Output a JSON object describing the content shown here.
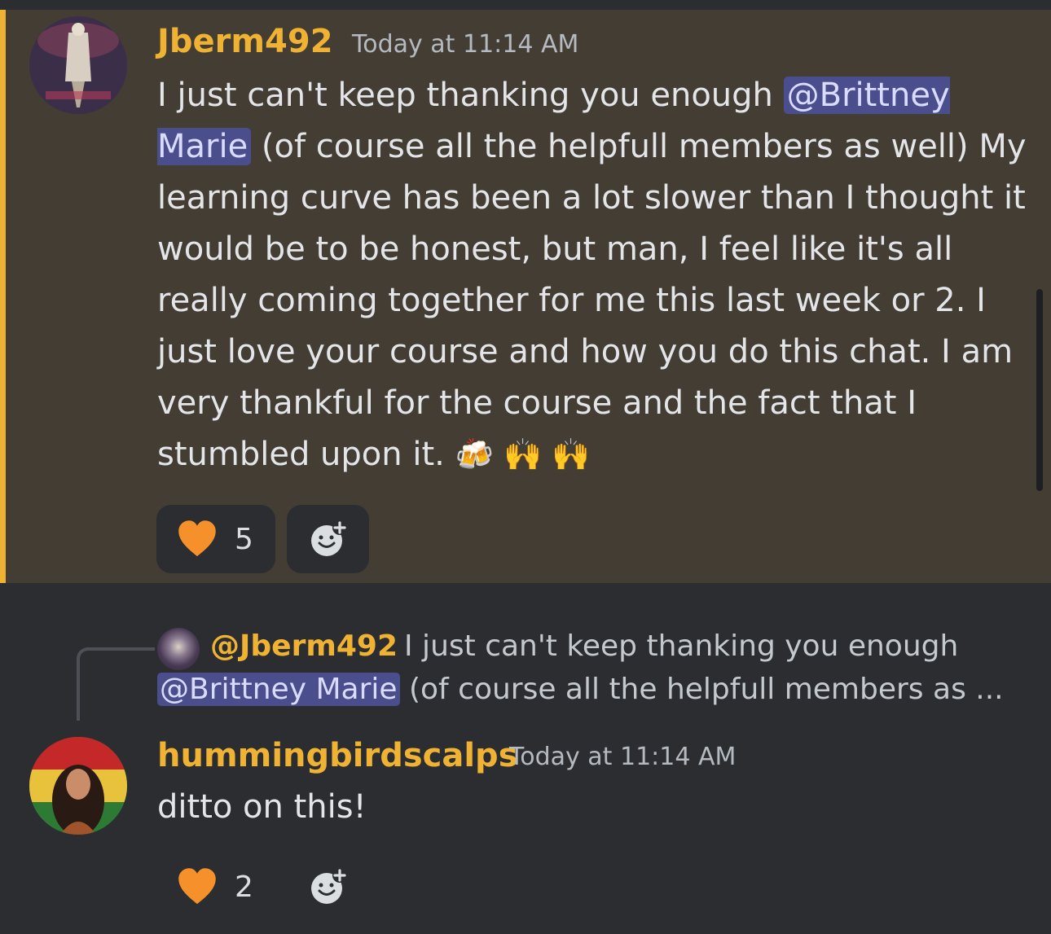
{
  "messages": [
    {
      "author": "Jberm492",
      "timestamp": "Today at 11:14 AM",
      "text_before_mention": "I just can't keep thanking you enough ",
      "mention": "@Brittney Marie",
      "text_after_mention": " (of course all the helpfull members as well) My learning curve has been a lot slower than I thought it would be to be honest, but man, I feel like it's all really coming together for me this last week or 2. I just love your course and how you do this chat. I am very thankful for the course and the fact that I stumbled upon it. ",
      "emojis": "🍻 🙌 🙌",
      "reaction": {
        "emoji": "orange-heart-icon",
        "count": "5"
      },
      "add_reaction_icon": "add-reaction-icon",
      "highlighted": true,
      "highlight_color": "#433d33",
      "accent_color": "#f0b232"
    },
    {
      "author": "hummingbirdscalps",
      "timestamp": "Today at 11:14 AM",
      "text": "ditto on this!",
      "reply": {
        "author": "@Jberm492",
        "line1": "I just can't keep thanking you enough",
        "mention": "@Brittney Marie",
        "line2_rest": " (of course all the helpfull members as ..."
      },
      "reaction": {
        "emoji": "orange-heart-icon",
        "count": "2"
      },
      "add_reaction_icon": "add-reaction-icon"
    }
  ],
  "colors": {
    "background": "#2b2d31",
    "username": "#f0b232",
    "mention_bg": "#4b4e8c",
    "heart": "#f5902a"
  }
}
